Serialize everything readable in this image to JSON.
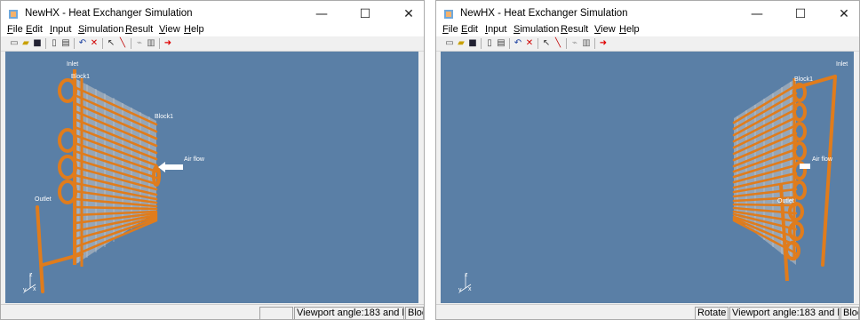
{
  "windows": [
    {
      "title": "NewHX - Heat Exchanger Simulation",
      "menu": [
        "File",
        "Edit",
        "Input",
        "Simulation",
        "Result",
        "View",
        "Help"
      ],
      "labels": {
        "inlet": "Inlet",
        "block1_top": "Block1",
        "block1": "Block1",
        "airflow": "Air flow",
        "outlet": "Outlet",
        "axis_y": "y",
        "axis_z": "z",
        "axis_x": "x"
      },
      "status": {
        "mode": "",
        "viewport": "Viewport angle:183 and heig",
        "block": "Bloc"
      }
    },
    {
      "title": "NewHX - Heat Exchanger Simulation",
      "menu": [
        "File",
        "Edit",
        "Input",
        "Simulation",
        "Result",
        "View",
        "Help"
      ],
      "labels": {
        "inlet": "Inlet",
        "block1": "Block1",
        "airflow": "Air flow",
        "outlet": "Outlet",
        "axis_y": "y",
        "axis_z": "z",
        "axis_x": "x"
      },
      "status": {
        "mode": "Rotate",
        "viewport": "Viewport angle:183 and heig",
        "block": "Bloc"
      }
    }
  ],
  "controls": {
    "minimize": "—",
    "maximize": "☐",
    "close": "✕"
  },
  "icons": [
    "app-icon",
    "new-icon",
    "open-icon",
    "save-icon",
    "print-preview-icon",
    "print-icon",
    "undo-icon",
    "delete-icon",
    "select-pointer-icon",
    "draw-line-icon",
    "connect-icon",
    "properties-icon",
    "run-arrow-icon"
  ],
  "colors": {
    "viewport_bg": "#5a7fa6",
    "tube": "#e07c1c",
    "fin": "#c9c9c9"
  }
}
